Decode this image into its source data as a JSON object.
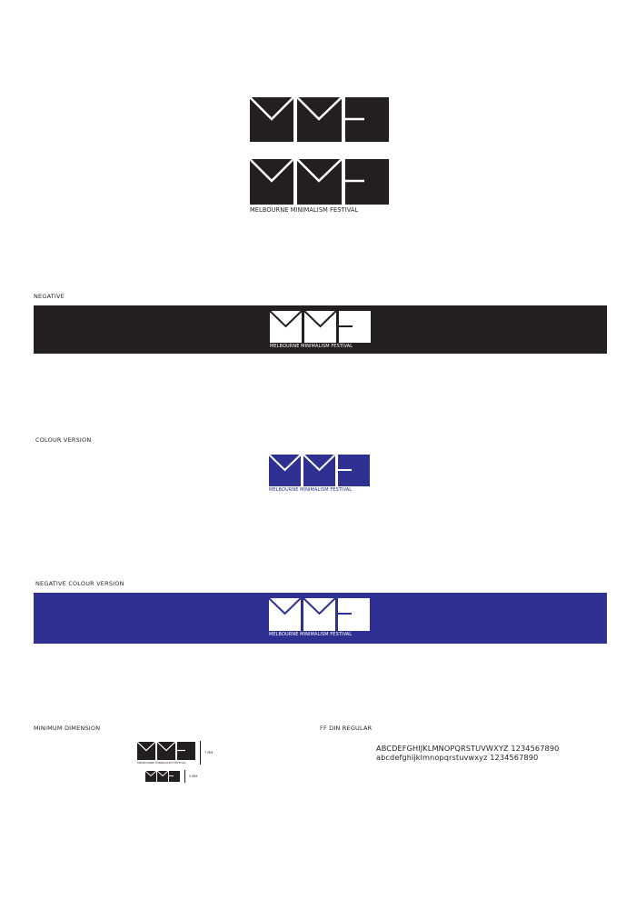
{
  "logo": {
    "name": "MELBOURNE MINIMALISM FESTIVAL"
  },
  "sections": {
    "negative": "NEGATIVE",
    "colour_version": "COLOUR VERSION",
    "negative_colour_version": "NEGATIVE COLOUR VERSION",
    "minimum_dimension": "MINIMUM DIMENSION",
    "font_name": "FF DIN REGULAR"
  },
  "minimum_dimension": {
    "large_size": "7 MM",
    "small_size": "5 MM"
  },
  "font_sample": {
    "uppercase": "ABCDEFGHIJKLMNOPQRSTUVWXYZ 1234567890",
    "lowercase": "abcdefghijklmnopqrstuvwxyz 1234567890"
  },
  "colors": {
    "black": "#231f20",
    "blue": "#2e3192",
    "white": "#ffffff"
  },
  "icons": [
    "mmf-logo-mark"
  ]
}
